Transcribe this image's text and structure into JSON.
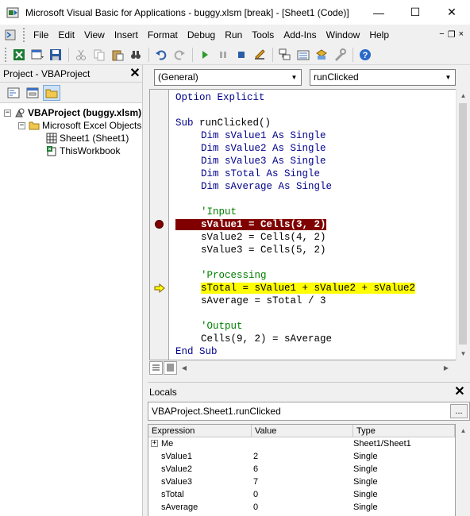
{
  "window": {
    "title": "Microsoft Visual Basic for Applications - buggy.xlsm [break] - [Sheet1 (Code)]",
    "minimize": "—",
    "maximize": "☐",
    "close": "✕"
  },
  "menu": {
    "items": [
      "File",
      "Edit",
      "View",
      "Insert",
      "Format",
      "Debug",
      "Run",
      "Tools",
      "Add-Ins",
      "Window",
      "Help"
    ],
    "mdi_min": "−",
    "mdi_restore": "❐",
    "mdi_close": "×"
  },
  "project": {
    "title": "Project - VBAProject",
    "close": "✕",
    "tree": {
      "root": "VBAProject (buggy.xlsm)",
      "folder": "Microsoft Excel Objects",
      "sheet": "Sheet1 (Sheet1)",
      "workbook": "ThisWorkbook"
    }
  },
  "code": {
    "object_combo": "(General)",
    "proc_combo": "runClicked",
    "lines": {
      "l1_kw": "Option Explicit",
      "l3_kw": "Sub",
      "l3_rest": " runClicked()",
      "l4": "Dim sValue1 As Single",
      "l5": "Dim sValue2 As Single",
      "l6": "Dim sValue3 As Single",
      "l7": "Dim sTotal As Single",
      "l8": "Dim sAverage As Single",
      "l10": "'Input",
      "l11": "sValue1 = Cells(3, 2)",
      "l12": "sValue2 = Cells(4, 2)",
      "l13": "sValue3 = Cells(5, 2)",
      "l15": "'Processing",
      "l16": "sTotal = sValue1 + sValue2 + sValue2",
      "l17": "sAverage = sTotal / 3",
      "l19": "'Output",
      "l20": "Cells(9, 2) = sAverage",
      "l21": "End Sub"
    }
  },
  "locals": {
    "title": "Locals",
    "close": "✕",
    "context": "VBAProject.Sheet1.runClicked",
    "context_btn": "...",
    "headers": [
      "Expression",
      "Value",
      "Type"
    ],
    "rows": [
      {
        "expr": "Me",
        "value": "",
        "type": "Sheet1/Sheet1"
      },
      {
        "expr": "sValue1",
        "value": "2",
        "type": "Single"
      },
      {
        "expr": "sValue2",
        "value": "6",
        "type": "Single"
      },
      {
        "expr": "sValue3",
        "value": "7",
        "type": "Single"
      },
      {
        "expr": "sTotal",
        "value": "0",
        "type": "Single"
      },
      {
        "expr": "sAverage",
        "value": "0",
        "type": "Single"
      }
    ]
  }
}
